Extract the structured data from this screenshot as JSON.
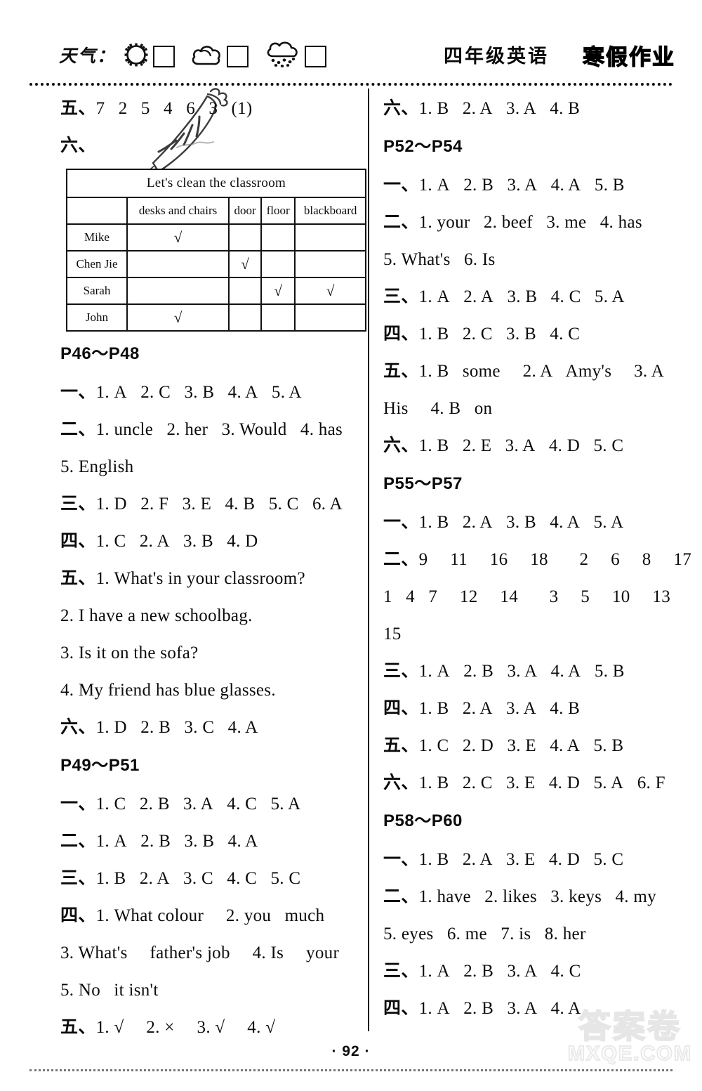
{
  "header": {
    "weather_label": "天气：",
    "weather_icons": [
      "sun-icon",
      "cloud-icon",
      "rain-icon"
    ],
    "title": "四年级英语",
    "subtitle": "寒假作业"
  },
  "left_column": {
    "top_lines": [
      {
        "cn": "五、",
        "text": "7  2  5  4  6  3  (1)"
      },
      {
        "cn": "六、",
        "text": ""
      }
    ],
    "table": {
      "title": "Let's clean the classroom",
      "columns": [
        "",
        "desks and chairs",
        "door",
        "floor",
        "blackboard"
      ],
      "check_mark": "√",
      "rows": [
        {
          "name": "Mike",
          "marks": [
            true,
            false,
            false,
            false
          ]
        },
        {
          "name": "Chen Jie",
          "marks": [
            false,
            true,
            false,
            false
          ]
        },
        {
          "name": "Sarah",
          "marks": [
            false,
            false,
            true,
            true
          ]
        },
        {
          "name": "John",
          "marks": [
            true,
            false,
            false,
            false
          ]
        }
      ]
    },
    "sections": [
      {
        "heading": "P46～P48",
        "lines": [
          {
            "cn": "一、",
            "text": "1. A  2. C  3. B  4. A  5. A"
          },
          {
            "cn": "二、",
            "text": "1. uncle  2. her  3. Would  4. has"
          },
          {
            "cn": "",
            "text": "5. English"
          },
          {
            "cn": "三、",
            "text": "1. D  2. F  3. E  4. B  5. C  6. A"
          },
          {
            "cn": "四、",
            "text": "1. C  2. A  3. B  4. D"
          },
          {
            "cn": "五、",
            "text": "1. What's in your classroom?"
          },
          {
            "cn": "",
            "text": "2. I have a new schoolbag."
          },
          {
            "cn": "",
            "text": "3. Is it on the sofa?"
          },
          {
            "cn": "",
            "text": "4. My friend has blue glasses."
          },
          {
            "cn": "六、",
            "text": "1. D  2. B  3. C  4. A"
          }
        ]
      },
      {
        "heading": "P49～P51",
        "lines": [
          {
            "cn": "一、",
            "text": "1. C  2. B  3. A  4. C  5. A"
          },
          {
            "cn": "二、",
            "text": "1. A  2. B  3. B  4. A"
          },
          {
            "cn": "三、",
            "text": "1. B  2. A  3. C  4. C  5. C"
          },
          {
            "cn": "四、",
            "text": "1. What colour  2. you  much"
          },
          {
            "cn": "",
            "text": "3. What's  father's job  4. Is  your"
          },
          {
            "cn": "",
            "text": "5. No  it isn't"
          },
          {
            "cn": "五、",
            "text": "1. √  2. ×  3. √  4. √"
          }
        ]
      }
    ]
  },
  "right_column": {
    "sections": [
      {
        "heading": "",
        "lines": [
          {
            "cn": "六、",
            "text": "1. B  2. A  3. A  4. B"
          }
        ]
      },
      {
        "heading": "P52～P54",
        "lines": [
          {
            "cn": "一、",
            "text": "1. A  2. B  3. A  4. A  5. B"
          },
          {
            "cn": "二、",
            "text": "1. your  2. beef  3. me  4. has"
          },
          {
            "cn": "",
            "text": "5. What's  6. Is"
          },
          {
            "cn": "三、",
            "text": "1. A  2. A  3. B  4. C  5. A"
          },
          {
            "cn": "四、",
            "text": "1. B  2. C  3. B  4. C"
          },
          {
            "cn": "五、",
            "text": "1. B  some  2. A  Amy's  3. A"
          },
          {
            "cn": "",
            "text": "His  4. B  on"
          },
          {
            "cn": "六、",
            "text": "1. B  2. E  3. A  4. D  5. C"
          }
        ]
      },
      {
        "heading": "P55～P57",
        "lines": [
          {
            "cn": "一、",
            "text": "1. B  2. A  3. B  4. A  5. A"
          },
          {
            "cn": "二、",
            "text": "9  11  16  18   2  6  8  17"
          },
          {
            "cn": "",
            "text": "1  4  7  12  14   3  5  10  13"
          },
          {
            "cn": "",
            "text": "15"
          },
          {
            "cn": "三、",
            "text": "1. A  2. B  3. A  4. A  5. B"
          },
          {
            "cn": "四、",
            "text": "1. B  2. A  3. A  4. B"
          },
          {
            "cn": "五、",
            "text": "1. C  2. D  3. E  4. A  5. B"
          },
          {
            "cn": "六、",
            "text": "1. B  2. C  3. E  4. D  5. A  6. F"
          }
        ]
      },
      {
        "heading": "P58～P60",
        "lines": [
          {
            "cn": "一、",
            "text": "1. B  2. A  3. E  4. D  5. C"
          },
          {
            "cn": "二、",
            "text": "1. have  2. likes  3. keys  4. my"
          },
          {
            "cn": "",
            "text": "5. eyes  6. me  7. is  8. her"
          },
          {
            "cn": "三、",
            "text": "1. A  2. B  3. A  4. C"
          },
          {
            "cn": "四、",
            "text": "1. A  2. B  3. A  4. A"
          }
        ]
      }
    ]
  },
  "footer": {
    "page_number": "· 92 ·"
  },
  "watermark": {
    "chinese": "答案卷",
    "domain": "MXQE.COM"
  }
}
